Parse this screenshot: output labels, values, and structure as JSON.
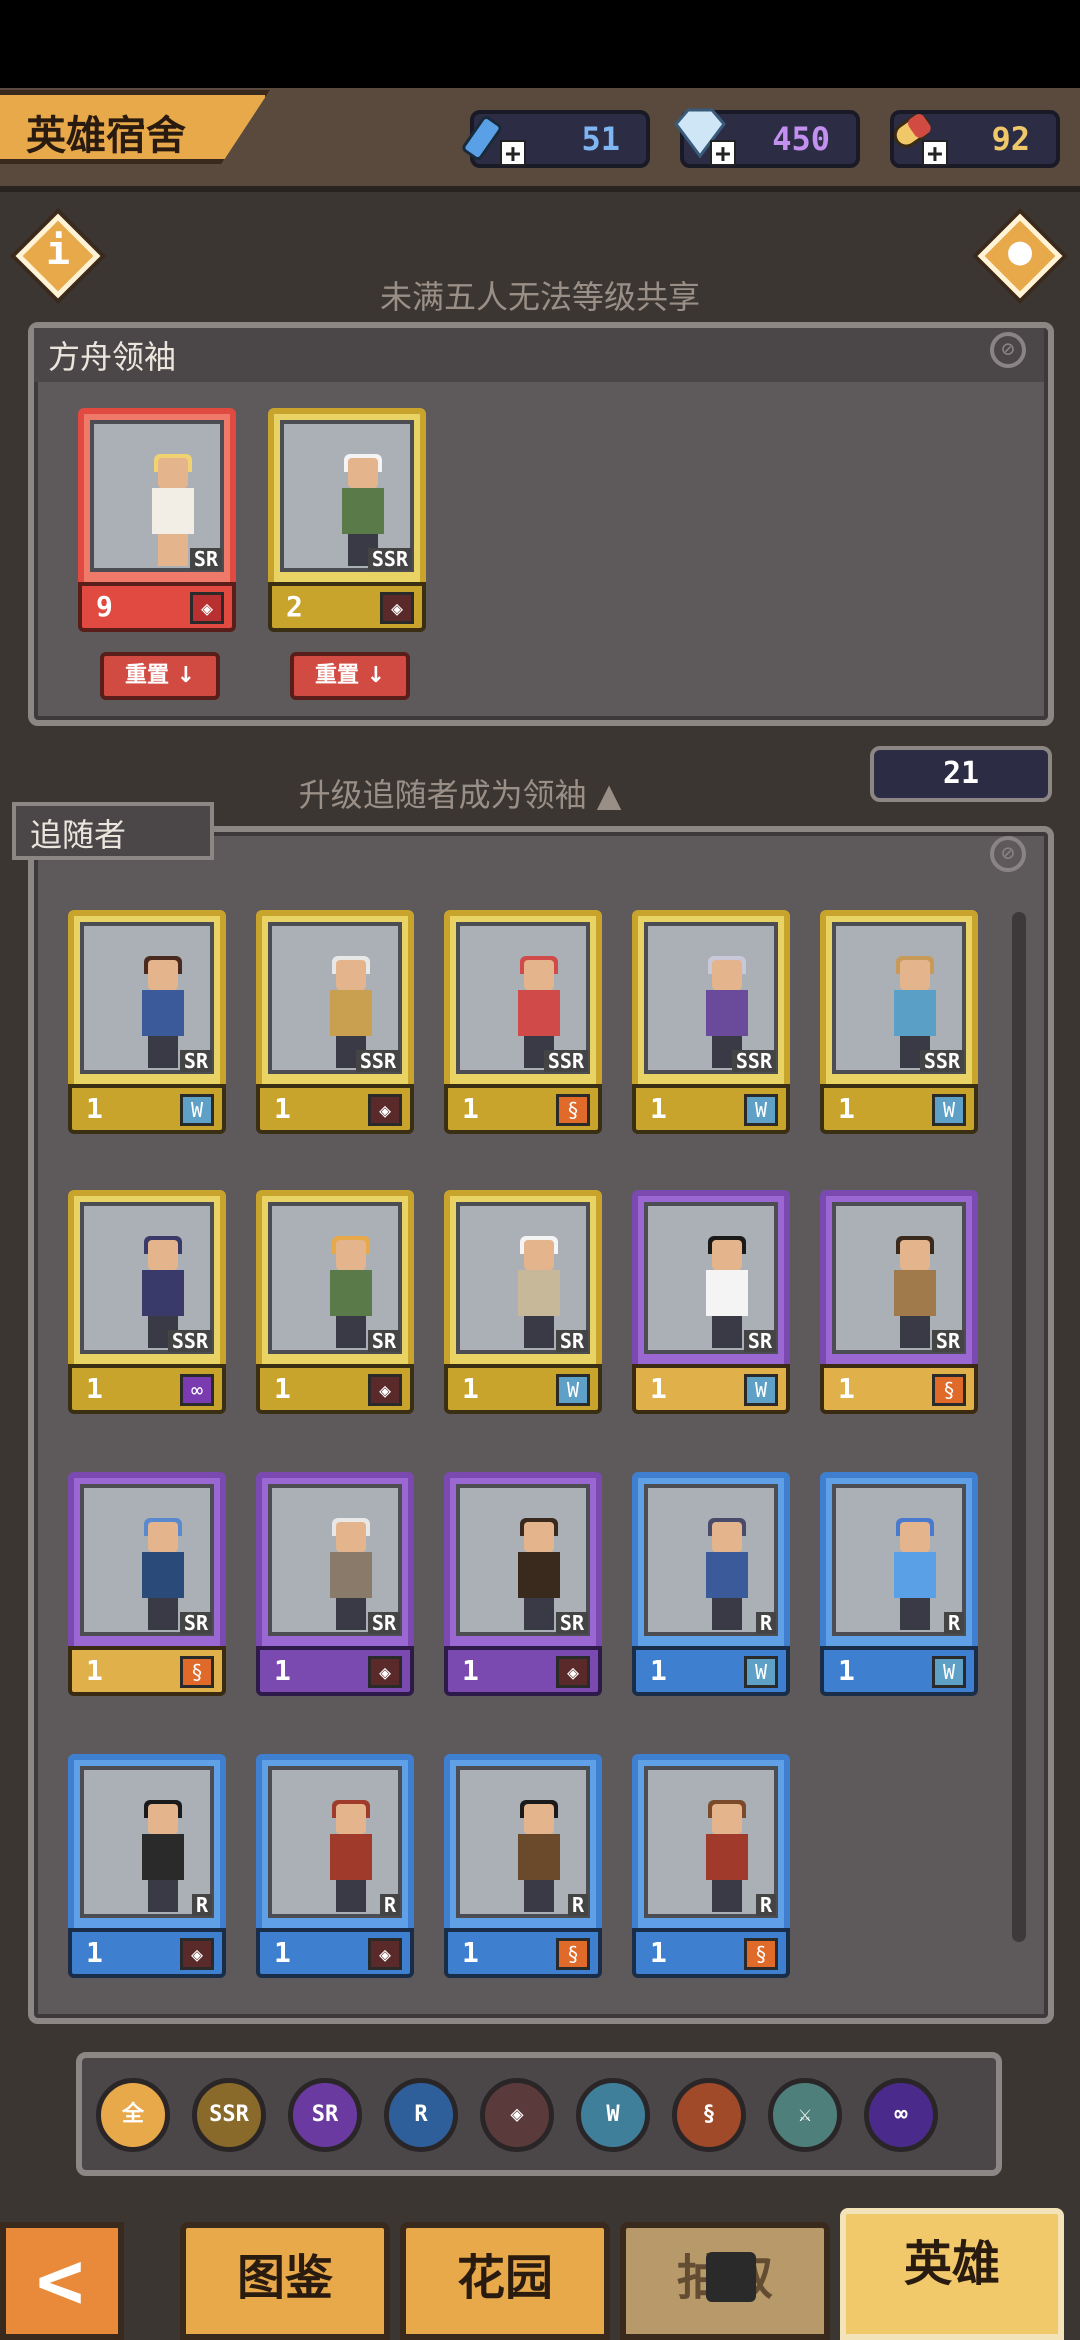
{
  "title": "英雄宿舍",
  "resources": [
    {
      "name": "potion",
      "value": "51",
      "color": "#5aa0e6"
    },
    {
      "name": "diamond",
      "value": "450",
      "color": "#b07be8"
    },
    {
      "name": "pill",
      "value": "92",
      "color": "#f0c86a"
    }
  ],
  "hints": {
    "leader_share": "未满五人无法等级共享",
    "upgrade": "升级追随者成为领袖"
  },
  "leader_panel": {
    "label": "方舟领袖",
    "reset_label": "重置",
    "leaders": [
      {
        "level": "9",
        "rarity": "SR",
        "faction": "mark"
      },
      {
        "level": "2",
        "rarity": "SSR",
        "faction": "mark"
      }
    ]
  },
  "follower_count": "21",
  "follower_panel": {
    "label": "追随者",
    "followers": [
      {
        "level": "1",
        "rarity": "SR",
        "faction": "wolf",
        "tier": "gold"
      },
      {
        "level": "1",
        "rarity": "SSR",
        "faction": "mark",
        "tier": "gold"
      },
      {
        "level": "1",
        "rarity": "SSR",
        "faction": "dragon",
        "tier": "gold"
      },
      {
        "level": "1",
        "rarity": "SSR",
        "faction": "wolf",
        "tier": "gold"
      },
      {
        "level": "1",
        "rarity": "SSR",
        "faction": "wolf",
        "tier": "gold"
      },
      {
        "level": "1",
        "rarity": "SSR",
        "faction": "infinity",
        "tier": "gold"
      },
      {
        "level": "1",
        "rarity": "SR",
        "faction": "mark",
        "tier": "gold"
      },
      {
        "level": "1",
        "rarity": "SR",
        "faction": "wolf",
        "tier": "gold"
      },
      {
        "level": "1",
        "rarity": "SR",
        "faction": "wolf",
        "tier": "purple-gold"
      },
      {
        "level": "1",
        "rarity": "SR",
        "faction": "dragon",
        "tier": "purple-gold"
      },
      {
        "level": "1",
        "rarity": "SR",
        "faction": "dragon",
        "tier": "purple-gold"
      },
      {
        "level": "1",
        "rarity": "SR",
        "faction": "mark",
        "tier": "purple"
      },
      {
        "level": "1",
        "rarity": "SR",
        "faction": "mark",
        "tier": "purple"
      },
      {
        "level": "1",
        "rarity": "R",
        "faction": "wolf",
        "tier": "blue"
      },
      {
        "level": "1",
        "rarity": "R",
        "faction": "wolf",
        "tier": "blue"
      },
      {
        "level": "1",
        "rarity": "R",
        "faction": "mark",
        "tier": "blue"
      },
      {
        "level": "1",
        "rarity": "R",
        "faction": "mark",
        "tier": "blue"
      },
      {
        "level": "1",
        "rarity": "R",
        "faction": "dragon",
        "tier": "blue"
      },
      {
        "level": "1",
        "rarity": "R",
        "faction": "dragon",
        "tier": "blue"
      }
    ]
  },
  "filters": [
    {
      "label": "全",
      "color": "#e8a94a"
    },
    {
      "label": "SSR",
      "color": "#8a6a2a"
    },
    {
      "label": "SR",
      "color": "#6a3aa0"
    },
    {
      "label": "R",
      "color": "#2f5f9a"
    },
    {
      "label": "",
      "color": "#5a3a3a"
    },
    {
      "label": "",
      "color": "#3f7f9a"
    },
    {
      "label": "",
      "color": "#a04a2a"
    },
    {
      "label": "",
      "color": "#4f7f7a"
    },
    {
      "label": "",
      "color": "#4a2a8a"
    }
  ],
  "nav": {
    "back": "<",
    "tabs": [
      "图鉴",
      "花园",
      "抽取",
      "英雄"
    ]
  }
}
